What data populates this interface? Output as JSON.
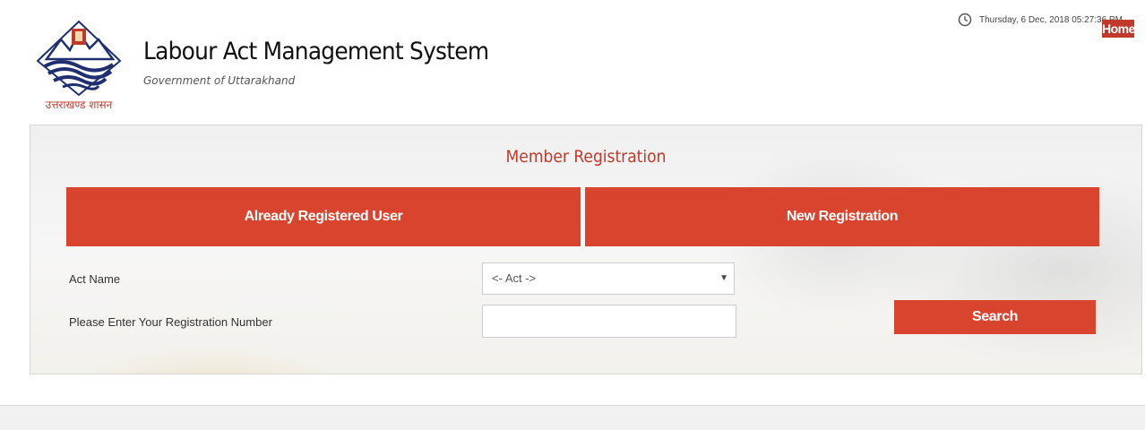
{
  "header": {
    "title": "Labour Act Management System",
    "subtitle": "Government of Uttarakhand",
    "logo_text": "उत्तराखण्ड शासन",
    "datetime": "Thursday, 6 Dec, 2018 05:27:36 PM",
    "home_label": "Home"
  },
  "panel": {
    "title": "Member Registration",
    "tabs": [
      {
        "label": "Already Registered User"
      },
      {
        "label": "New Registration"
      }
    ],
    "act_label": "Act Name",
    "act_selected": "<- Act ->",
    "reg_label": "Please Enter Your Registration Number",
    "reg_value": "",
    "search_label": "Search"
  },
  "colors": {
    "accent": "#d9442f",
    "brand_red": "#c0392b",
    "logo_blue": "#1f2f6f"
  },
  "icons": {
    "clock": "clock-icon",
    "select_arrow": "caret-down-icon"
  }
}
